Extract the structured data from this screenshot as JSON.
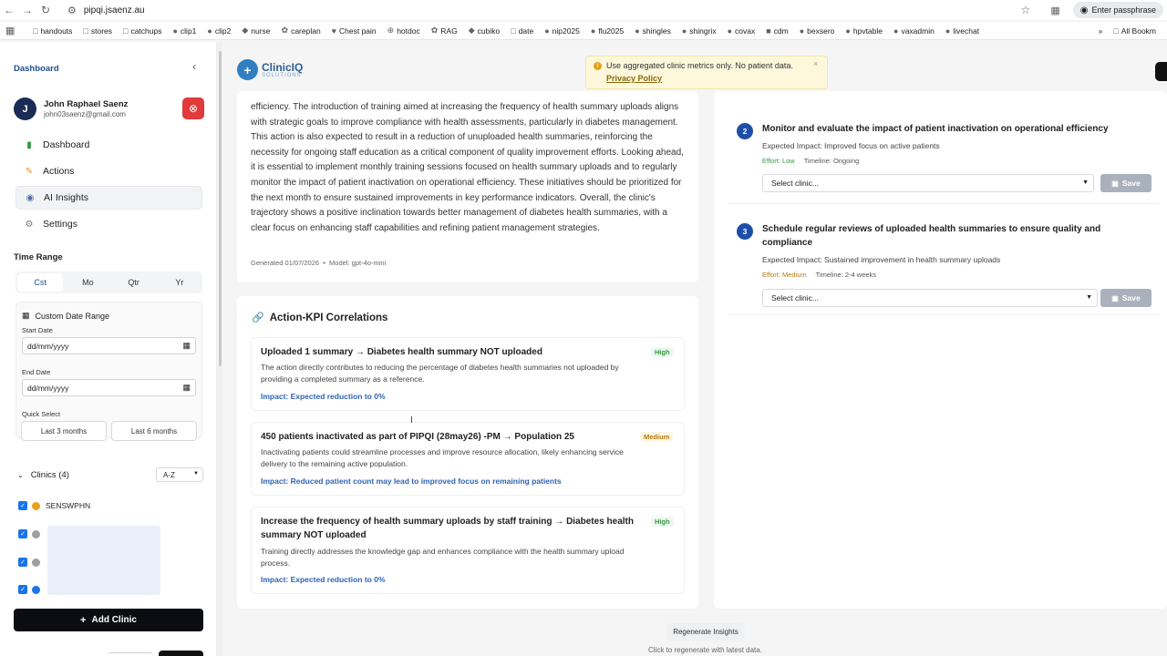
{
  "browser": {
    "url": "pipqi.jsaenz.au",
    "passphrase_button": "Enter passphrase",
    "bookmarks": [
      "handouts",
      "stores",
      "catchups",
      "clip1",
      "clip2",
      "nurse",
      "careplan",
      "Chest pain",
      "hotdoc",
      "RAG",
      "cubiko",
      "date",
      "nip2025",
      "flu2025",
      "shingles",
      "shingrix",
      "covax",
      "cdm",
      "bexsero",
      "hpvtable",
      "vaxadmin",
      "livechat"
    ],
    "all_bookmarks": "All Bookm"
  },
  "sidebar": {
    "title": "Dashboard",
    "user": {
      "initial": "J",
      "name": "John Raphael Saenz",
      "email": "john03saenz@gmail.com"
    },
    "menu": [
      {
        "label": "Dashboard",
        "icon": "bar-chart-icon"
      },
      {
        "label": "Actions",
        "icon": "pencil-icon"
      },
      {
        "label": "AI Insights",
        "icon": "robot-icon"
      },
      {
        "label": "Settings",
        "icon": "gear-icon"
      }
    ],
    "time_range": {
      "label": "Time Range",
      "tabs": [
        "Cst",
        "Mo",
        "Qtr",
        "Yr"
      ],
      "active": "Cst"
    },
    "custom_range": {
      "title": "Custom Date Range",
      "start_label": "Start Date",
      "start_value": "dd/mm/yyyy",
      "end_label": "End Date",
      "end_value": "dd/mm/yyyy",
      "quick_label": "Quick Select",
      "quick_options": [
        "Last 3 months",
        "Last 6 months"
      ]
    },
    "clinics": {
      "header": "Clinics (4)",
      "sort": "A-Z",
      "items": [
        {
          "name": "SENSWPHN",
          "color": "#e8a21a"
        },
        {
          "name": "",
          "color": "#9e9e9e"
        },
        {
          "name": "",
          "color": "#9e9e9e"
        },
        {
          "name": "",
          "color": "#1a73e8"
        }
      ]
    },
    "add_clinic": "Add Clinic"
  },
  "brand": {
    "name": "ClinicIQ",
    "sub": "SOLUTIONS"
  },
  "banner": {
    "message": "Use aggregated clinic metrics only. No patient data.",
    "link": "Privacy Policy"
  },
  "summary": {
    "text": "efficiency. The introduction of training aimed at increasing the frequency of health summary uploads aligns with strategic goals to improve compliance with health assessments, particularly in diabetes management. This action is also expected to result in a reduction of unuploaded health summaries, reinforcing the necessity for ongoing staff education as a critical component of quality improvement efforts. Looking ahead, it is essential to implement monthly training sessions focused on health summary uploads and to regularly monitor the impact of patient inactivation on operational efficiency. These initiatives should be prioritized for the next month to ensure sustained improvements in key performance indicators. Overall, the clinic's trajectory shows a positive inclination towards better management of diabetes health summaries, with a clear focus on enhancing staff capabilities and refining patient management strategies.",
    "generated": "Generated 01/07/2026",
    "model": "Model: gpt-4o-mini"
  },
  "correlations": {
    "title": "Action-KPI Correlations",
    "items": [
      {
        "title": "Uploaded 1 summary → Diabetes health summary NOT uploaded",
        "badge": "High",
        "desc": "The action directly contributes to reducing the percentage of diabetes health summaries not uploaded by providing a completed summary as a reference.",
        "impact": "Impact: Expected reduction to 0%"
      },
      {
        "title": "450 patients inactivated as part of PIPQI (28may26) -PM → Population 25",
        "badge": "Medium",
        "desc": "Inactivating patients could streamline processes and improve resource allocation, likely enhancing service delivery to the remaining active population.",
        "impact": "Impact: Reduced patient count may lead to improved focus on remaining patients"
      },
      {
        "title": "Increase the frequency of health summary uploads by staff training → Diabetes health summary NOT uploaded",
        "badge": "High",
        "desc": "Training directly addresses the knowledge gap and enhances compliance with the health summary upload process.",
        "impact": "Impact: Expected reduction to 0%"
      }
    ]
  },
  "recommendations": [
    {
      "num": "2",
      "title": "Monitor and evaluate the impact of patient inactivation on operational efficiency",
      "expected": "Expected Impact: Improved focus on active patients",
      "effort": "Effort: Low",
      "timeline": "Timeline: Ongoing",
      "select": "Select clinic...",
      "save": "Save"
    },
    {
      "num": "3",
      "title": "Schedule regular reviews of uploaded health summaries to ensure quality and compliance",
      "expected": "Expected Impact: Sustained improvement in health summary uploads",
      "effort": "Effort: Medium",
      "timeline": "Timeline: 2-4 weeks",
      "select": "Select clinic...",
      "save": "Save"
    }
  ],
  "regenerate": {
    "button": "Regenerate Insights",
    "hint": "Click to regenerate with latest data."
  }
}
